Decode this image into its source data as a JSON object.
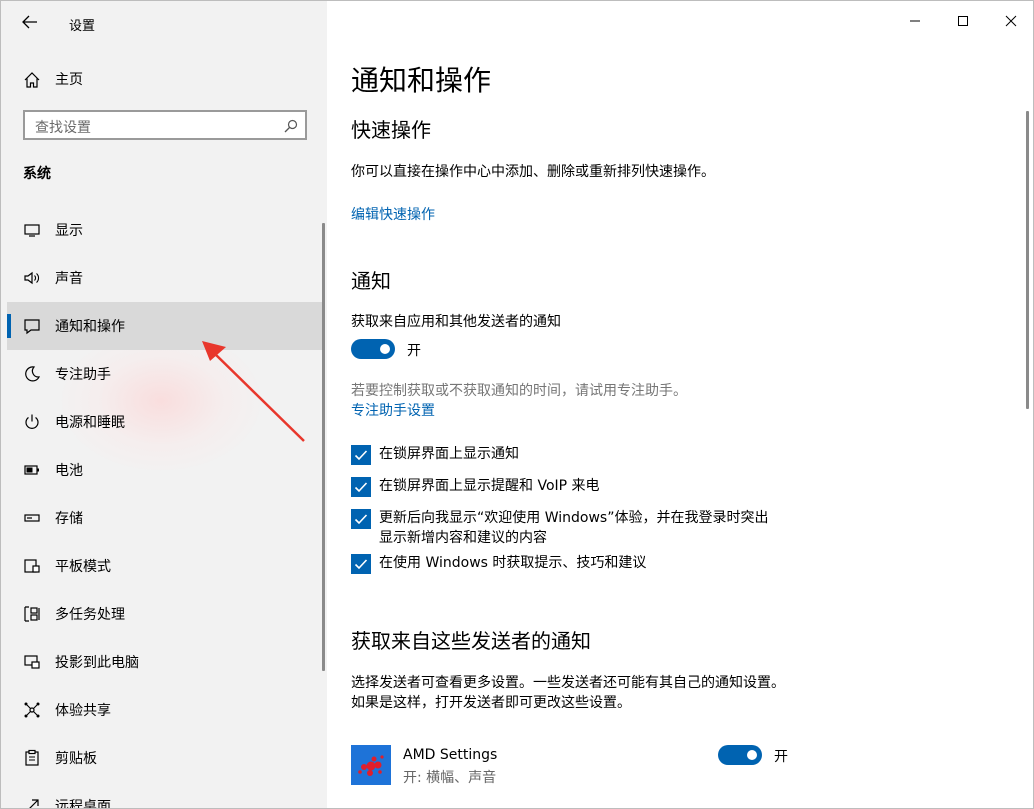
{
  "window": {
    "app_title": "设置",
    "controls": [
      "minimize-icon",
      "maximize-icon",
      "close-icon"
    ]
  },
  "sidebar": {
    "home_label": "主页",
    "search_placeholder": "查找设置",
    "section_title": "系统",
    "items": [
      {
        "label": "显示",
        "icon": "display-icon",
        "active": false
      },
      {
        "label": "声音",
        "icon": "speaker-icon",
        "active": false
      },
      {
        "label": "通知和操作",
        "icon": "notification-icon",
        "active": true
      },
      {
        "label": "专注助手",
        "icon": "moon-icon",
        "active": false
      },
      {
        "label": "电源和睡眠",
        "icon": "power-icon",
        "active": false
      },
      {
        "label": "电池",
        "icon": "battery-icon",
        "active": false
      },
      {
        "label": "存储",
        "icon": "storage-icon",
        "active": false
      },
      {
        "label": "平板模式",
        "icon": "tablet-icon",
        "active": false
      },
      {
        "label": "多任务处理",
        "icon": "multitask-icon",
        "active": false
      },
      {
        "label": "投影到此电脑",
        "icon": "project-icon",
        "active": false
      },
      {
        "label": "体验共享",
        "icon": "share-icon",
        "active": false
      },
      {
        "label": "剪贴板",
        "icon": "clipboard-icon",
        "active": false
      },
      {
        "label": "远程桌面",
        "icon": "remote-icon",
        "active": false
      }
    ]
  },
  "main": {
    "page_title": "通知和操作",
    "quick_actions": {
      "heading": "快速操作",
      "description": "你可以直接在操作中心中添加、删除或重新排列快速操作。",
      "edit_link": "编辑快速操作"
    },
    "notifications": {
      "heading": "通知",
      "get_notifications_label": "获取来自应用和其他发送者的通知",
      "toggle_state": "开",
      "hint": "若要控制获取或不获取通知的时间，请试用专注助手。",
      "focus_link": "专注助手设置",
      "checkboxes": [
        {
          "line1": "在锁屏界面上显示通知",
          "line2": ""
        },
        {
          "line1": "在锁屏界面上显示提醒和 VoIP 来电",
          "line2": ""
        },
        {
          "line1": "更新后向我显示“欢迎使用 Windows”体验，并在我登录时突出",
          "line2": "显示新增内容和建议的内容"
        },
        {
          "line1": "在使用 Windows 时获取提示、技巧和建议",
          "line2": ""
        }
      ]
    },
    "senders": {
      "heading": "获取来自这些发送者的通知",
      "desc_line1": "选择发送者可查看更多设置。一些发送者还可能有其自己的通知设置。",
      "desc_line2": "如果是这样，打开发送者即可更改这些设置。",
      "apps": [
        {
          "name": "AMD Settings",
          "sub": "开: 横幅、声音",
          "toggle_state": "开"
        }
      ]
    }
  },
  "colors": {
    "accent": "#0063b1",
    "sidebar_bg": "#f2f2f2",
    "active_item_bg": "#d9d9d9",
    "annotation_arrow": "#e8372c"
  }
}
